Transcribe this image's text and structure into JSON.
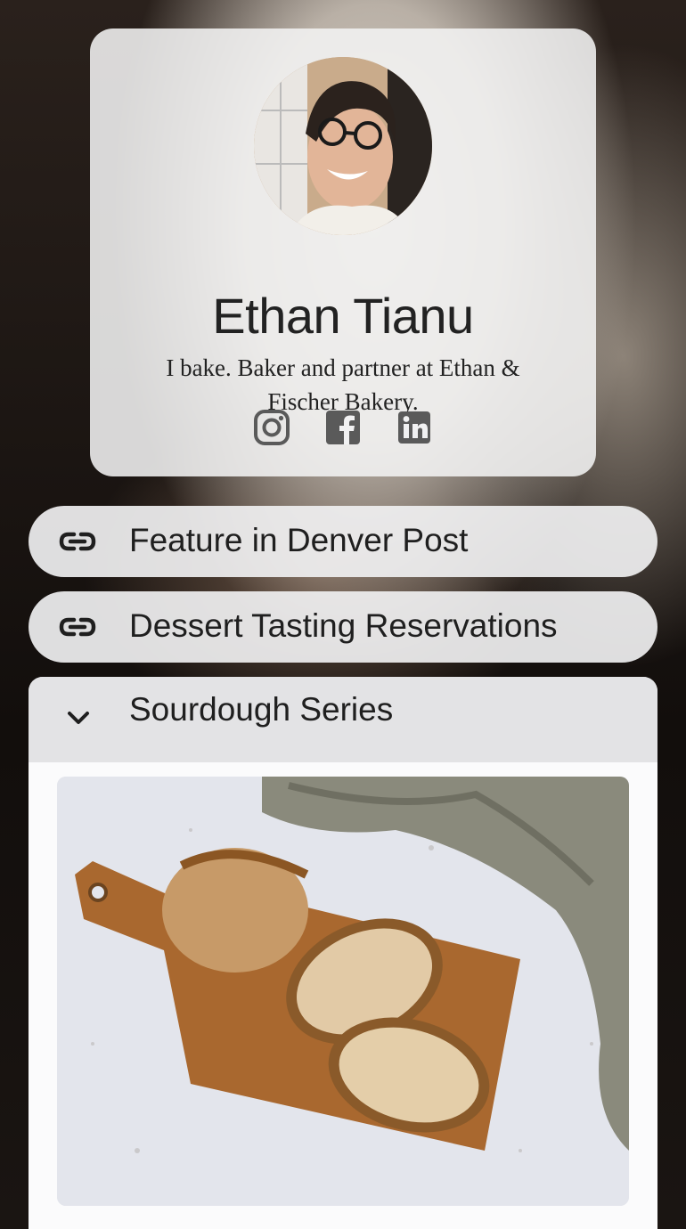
{
  "profile": {
    "name": "Ethan Tianu",
    "bio": "I bake. Baker and partner at Ethan & Fischer Bakery.",
    "avatar_icon": "avatar",
    "socials": [
      {
        "icon": "instagram-icon"
      },
      {
        "icon": "facebook-icon"
      },
      {
        "icon": "linkedin-icon"
      }
    ]
  },
  "links": [
    {
      "label": "Feature in Denver Post",
      "icon": "link-icon"
    },
    {
      "label": "Dessert Tasting Reservations",
      "icon": "link-icon"
    }
  ],
  "accordion": {
    "label": "Sourdough Series",
    "icon": "chevron-down-icon",
    "image": "sourdough-bread-photo"
  },
  "colors": {
    "card": "#f2f2f3",
    "text": "#222222",
    "icon": "#5a5a5a"
  }
}
